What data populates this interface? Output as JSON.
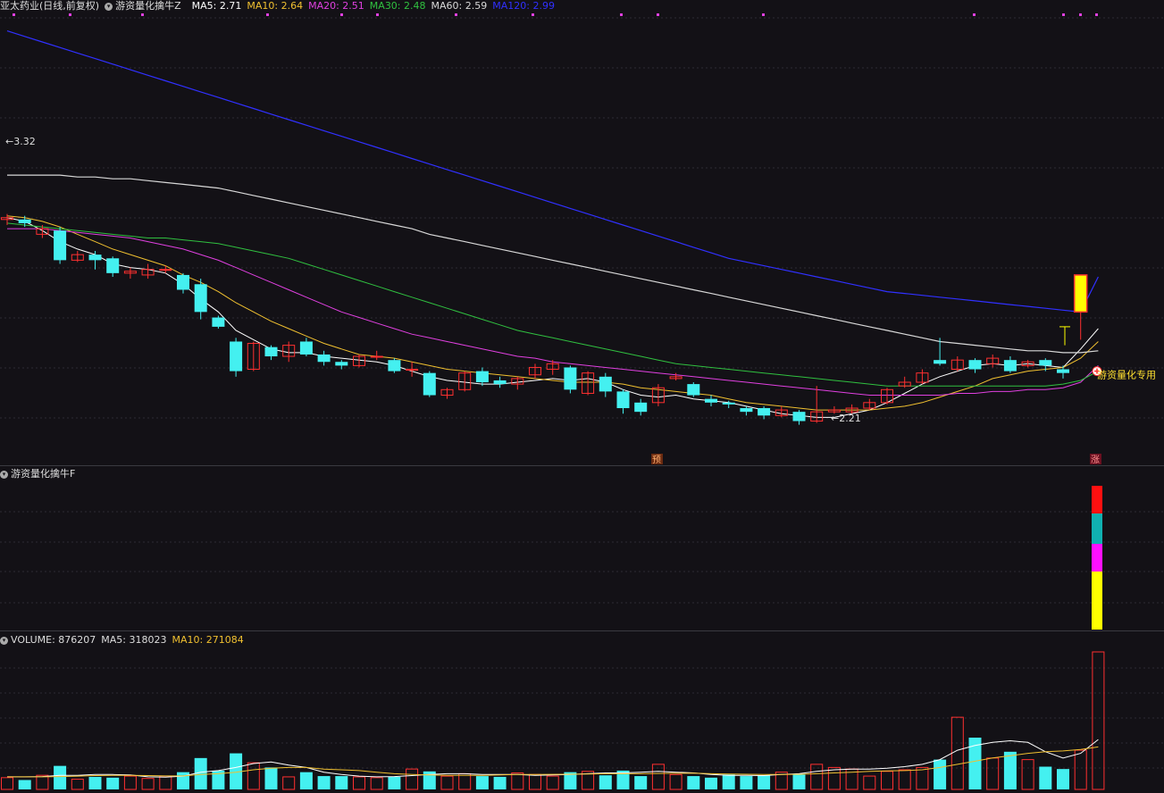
{
  "header": {
    "stock": "亚太药业(日线,前复权)",
    "indicator": "游资量化擒牛Z",
    "ma": [
      {
        "label": "MA5: 2.71",
        "color": "#ffffff"
      },
      {
        "label": "MA10: 2.64",
        "color": "#f0c030"
      },
      {
        "label": "MA20: 2.51",
        "color": "#e040e0"
      },
      {
        "label": "MA30: 2.48",
        "color": "#30c040"
      },
      {
        "label": "MA60: 2.59",
        "color": "#d8d8d8"
      },
      {
        "label": "MA120: 2.99",
        "color": "#3030ff"
      }
    ]
  },
  "panel2": {
    "title": "游资量化擒牛F"
  },
  "panel3": {
    "volume_label": "VOLUME: 876207",
    "ma5_label": "MA5: 318023",
    "ma10_label": "MA10: 271084"
  },
  "annotations": {
    "high_label": "3.32",
    "low_label": "2.21",
    "signal_label": "游资量化专用",
    "marker_yu": "预",
    "marker_zhang": "涨"
  },
  "colors": {
    "up": "#ff3030",
    "down": "#44f0f0",
    "yellow": "#ffff00",
    "bg": "#131116"
  },
  "chart_data": {
    "type": "candlestick",
    "candles": [
      [
        3.3,
        3.31,
        3.33,
        3.27
      ],
      [
        3.3,
        3.28,
        3.32,
        3.26
      ],
      [
        3.22,
        3.25,
        3.27,
        3.2
      ],
      [
        3.24,
        3.08,
        3.26,
        3.06
      ],
      [
        3.08,
        3.11,
        3.13,
        3.07
      ],
      [
        3.11,
        3.08,
        3.13,
        3.03
      ],
      [
        3.09,
        3.01,
        3.1,
        2.99
      ],
      [
        3.01,
        3.02,
        3.04,
        2.98
      ],
      [
        3.0,
        3.03,
        3.06,
        2.98
      ],
      [
        3.03,
        3.03,
        3.05,
        3.01
      ],
      [
        3.0,
        2.92,
        3.01,
        2.9
      ],
      [
        2.95,
        2.8,
        2.98,
        2.76
      ],
      [
        2.77,
        2.72,
        2.78,
        2.71
      ],
      [
        2.64,
        2.48,
        2.66,
        2.45
      ],
      [
        2.49,
        2.63,
        2.64,
        2.48
      ],
      [
        2.61,
        2.56,
        2.62,
        2.54
      ],
      [
        2.56,
        2.62,
        2.64,
        2.53
      ],
      [
        2.64,
        2.57,
        2.66,
        2.56
      ],
      [
        2.57,
        2.53,
        2.59,
        2.51
      ],
      [
        2.53,
        2.51,
        2.54,
        2.49
      ],
      [
        2.51,
        2.56,
        2.57,
        2.5
      ],
      [
        2.56,
        2.56,
        2.59,
        2.54
      ],
      [
        2.54,
        2.48,
        2.55,
        2.47
      ],
      [
        2.49,
        2.49,
        2.53,
        2.45
      ],
      [
        2.47,
        2.35,
        2.48,
        2.34
      ],
      [
        2.35,
        2.38,
        2.39,
        2.33
      ],
      [
        2.38,
        2.47,
        2.48,
        2.37
      ],
      [
        2.48,
        2.42,
        2.5,
        2.4
      ],
      [
        2.43,
        2.41,
        2.45,
        2.39
      ],
      [
        2.41,
        2.44,
        2.45,
        2.38
      ],
      [
        2.46,
        2.5,
        2.52,
        2.44
      ],
      [
        2.49,
        2.52,
        2.54,
        2.46
      ],
      [
        2.5,
        2.38,
        2.51,
        2.36
      ],
      [
        2.36,
        2.47,
        2.48,
        2.35
      ],
      [
        2.45,
        2.37,
        2.47,
        2.34
      ],
      [
        2.37,
        2.28,
        2.38,
        2.25
      ],
      [
        2.31,
        2.26,
        2.33,
        2.24
      ],
      [
        2.31,
        2.39,
        2.41,
        2.29
      ],
      [
        2.44,
        2.45,
        2.47,
        2.43
      ],
      [
        2.41,
        2.35,
        2.42,
        2.34
      ],
      [
        2.33,
        2.31,
        2.35,
        2.29
      ],
      [
        2.31,
        2.3,
        2.32,
        2.28
      ],
      [
        2.28,
        2.26,
        2.29,
        2.24
      ],
      [
        2.28,
        2.24,
        2.29,
        2.22
      ],
      [
        2.24,
        2.27,
        2.29,
        2.23
      ],
      [
        2.26,
        2.21,
        2.27,
        2.19
      ],
      [
        2.21,
        2.26,
        2.4,
        2.2
      ],
      [
        2.26,
        2.27,
        2.29,
        2.25
      ],
      [
        2.26,
        2.28,
        2.3,
        2.25
      ],
      [
        2.28,
        2.31,
        2.33,
        2.27
      ],
      [
        2.31,
        2.38,
        2.39,
        2.3
      ],
      [
        2.4,
        2.42,
        2.45,
        2.39
      ],
      [
        2.42,
        2.47,
        2.49,
        2.41
      ],
      [
        2.54,
        2.52,
        2.66,
        2.51
      ],
      [
        2.49,
        2.54,
        2.56,
        2.48
      ],
      [
        2.54,
        2.49,
        2.55,
        2.47
      ],
      [
        2.52,
        2.55,
        2.57,
        2.5
      ],
      [
        2.54,
        2.48,
        2.56,
        2.47
      ],
      [
        2.51,
        2.53,
        2.54,
        2.5
      ],
      [
        2.54,
        2.51,
        2.55,
        2.48
      ],
      [
        2.49,
        2.47,
        2.51,
        2.44
      ],
      [
        2.8,
        3.0,
        3.0,
        2.65
      ]
    ],
    "volume_max": 876207,
    "volume": [
      75000,
      60000,
      90000,
      150000,
      65000,
      80000,
      75000,
      85000,
      70000,
      85000,
      110000,
      200000,
      120000,
      230000,
      170000,
      140000,
      80000,
      110000,
      85000,
      85000,
      80000,
      75000,
      80000,
      130000,
      115000,
      85000,
      100000,
      85000,
      80000,
      105000,
      95000,
      85000,
      110000,
      115000,
      90000,
      120000,
      85000,
      160000,
      95000,
      85000,
      75000,
      95000,
      85000,
      90000,
      110000,
      100000,
      160000,
      140000,
      130000,
      85000,
      115000,
      125000,
      140000,
      190000,
      460000,
      330000,
      200000,
      240000,
      190000,
      145000,
      130000,
      250000,
      876207
    ],
    "series": [
      {
        "name": "MA5",
        "values": [
          3.31,
          3.29,
          3.24,
          3.18,
          3.14,
          3.11,
          3.06,
          3.04,
          3.03,
          3.01,
          2.95,
          2.87,
          2.8,
          2.7,
          2.65,
          2.6,
          2.58,
          2.58,
          2.56,
          2.55,
          2.54,
          2.53,
          2.51,
          2.48,
          2.45,
          2.43,
          2.42,
          2.41,
          2.41,
          2.42,
          2.43,
          2.44,
          2.43,
          2.44,
          2.42,
          2.38,
          2.35,
          2.34,
          2.35,
          2.33,
          2.32,
          2.31,
          2.29,
          2.27,
          2.25,
          2.24,
          2.23,
          2.23,
          2.25,
          2.27,
          2.31,
          2.36,
          2.41,
          2.45,
          2.48,
          2.51,
          2.52,
          2.51,
          2.52,
          2.51,
          2.5,
          2.6,
          2.71
        ]
      },
      {
        "name": "MA10",
        "values": [
          3.32,
          3.31,
          3.29,
          3.26,
          3.22,
          3.18,
          3.14,
          3.11,
          3.08,
          3.05,
          3.0,
          2.96,
          2.91,
          2.85,
          2.8,
          2.75,
          2.71,
          2.67,
          2.63,
          2.6,
          2.57,
          2.56,
          2.55,
          2.53,
          2.51,
          2.49,
          2.48,
          2.47,
          2.46,
          2.45,
          2.44,
          2.43,
          2.42,
          2.42,
          2.42,
          2.41,
          2.39,
          2.38,
          2.37,
          2.36,
          2.35,
          2.33,
          2.31,
          2.3,
          2.29,
          2.28,
          2.27,
          2.27,
          2.27,
          2.27,
          2.28,
          2.29,
          2.31,
          2.34,
          2.37,
          2.4,
          2.44,
          2.46,
          2.48,
          2.49,
          2.5,
          2.55,
          2.64
        ]
      },
      {
        "name": "MA20",
        "values": [
          3.25,
          3.25,
          3.25,
          3.24,
          3.23,
          3.22,
          3.21,
          3.2,
          3.18,
          3.16,
          3.14,
          3.11,
          3.08,
          3.04,
          3.0,
          2.96,
          2.92,
          2.88,
          2.84,
          2.8,
          2.77,
          2.74,
          2.71,
          2.68,
          2.66,
          2.64,
          2.62,
          2.6,
          2.58,
          2.56,
          2.55,
          2.53,
          2.52,
          2.51,
          2.5,
          2.49,
          2.48,
          2.47,
          2.46,
          2.45,
          2.44,
          2.43,
          2.42,
          2.41,
          2.4,
          2.39,
          2.38,
          2.37,
          2.36,
          2.35,
          2.35,
          2.35,
          2.35,
          2.35,
          2.36,
          2.36,
          2.37,
          2.37,
          2.38,
          2.38,
          2.39,
          2.42,
          2.51
        ]
      },
      {
        "name": "MA30",
        "values": [
          3.28,
          3.27,
          3.26,
          3.25,
          3.24,
          3.23,
          3.22,
          3.21,
          3.2,
          3.2,
          3.19,
          3.18,
          3.17,
          3.15,
          3.13,
          3.11,
          3.09,
          3.06,
          3.03,
          3.0,
          2.97,
          2.94,
          2.91,
          2.88,
          2.85,
          2.82,
          2.79,
          2.76,
          2.73,
          2.7,
          2.68,
          2.66,
          2.64,
          2.62,
          2.6,
          2.58,
          2.56,
          2.54,
          2.52,
          2.51,
          2.5,
          2.49,
          2.48,
          2.47,
          2.46,
          2.45,
          2.44,
          2.43,
          2.42,
          2.41,
          2.4,
          2.4,
          2.4,
          2.4,
          2.4,
          2.4,
          2.4,
          2.4,
          2.4,
          2.4,
          2.41,
          2.43,
          2.48
        ]
      },
      {
        "name": "MA60",
        "values": [
          3.54,
          3.54,
          3.54,
          3.54,
          3.53,
          3.53,
          3.52,
          3.52,
          3.51,
          3.5,
          3.49,
          3.48,
          3.47,
          3.45,
          3.43,
          3.41,
          3.39,
          3.37,
          3.35,
          3.33,
          3.31,
          3.29,
          3.27,
          3.25,
          3.22,
          3.2,
          3.18,
          3.16,
          3.14,
          3.12,
          3.1,
          3.08,
          3.06,
          3.04,
          3.02,
          3.0,
          2.98,
          2.96,
          2.94,
          2.92,
          2.9,
          2.88,
          2.86,
          2.84,
          2.82,
          2.8,
          2.78,
          2.76,
          2.74,
          2.72,
          2.7,
          2.68,
          2.66,
          2.64,
          2.63,
          2.62,
          2.61,
          2.6,
          2.59,
          2.59,
          2.58,
          2.58,
          2.59
        ]
      },
      {
        "name": "MA120",
        "values": [
          4.32,
          4.29,
          4.26,
          4.23,
          4.2,
          4.17,
          4.14,
          4.11,
          4.08,
          4.05,
          4.02,
          3.99,
          3.96,
          3.93,
          3.9,
          3.87,
          3.84,
          3.81,
          3.78,
          3.75,
          3.72,
          3.69,
          3.66,
          3.63,
          3.6,
          3.57,
          3.54,
          3.51,
          3.48,
          3.45,
          3.42,
          3.39,
          3.36,
          3.33,
          3.3,
          3.27,
          3.24,
          3.21,
          3.18,
          3.15,
          3.12,
          3.09,
          3.07,
          3.05,
          3.03,
          3.01,
          2.99,
          2.97,
          2.95,
          2.93,
          2.91,
          2.9,
          2.89,
          2.88,
          2.87,
          2.86,
          2.85,
          2.84,
          2.83,
          2.82,
          2.81,
          2.8,
          2.99
        ]
      }
    ],
    "volume_ma": [
      {
        "name": "MA5",
        "values": [
          80000,
          80000,
          82000,
          90000,
          90000,
          95000,
          95000,
          92000,
          80000,
          78000,
          85000,
          110000,
          120000,
          140000,
          165000,
          175000,
          155000,
          140000,
          110000,
          95000,
          85000,
          80000,
          82000,
          88000,
          95000,
          100000,
          100000,
          95000,
          95000,
          95000,
          90000,
          92000,
          95000,
          100000,
          105000,
          105000,
          110000,
          115000,
          110000,
          105000,
          95000,
          90000,
          90000,
          88000,
          95000,
          100000,
          115000,
          125000,
          130000,
          130000,
          135000,
          145000,
          160000,
          190000,
          250000,
          280000,
          300000,
          310000,
          300000,
          240000,
          200000,
          230000,
          318023
        ]
      },
      {
        "name": "MA10",
        "values": [
          80000,
          80000,
          80000,
          82000,
          85000,
          88000,
          90000,
          90000,
          88000,
          86000,
          86000,
          95000,
          100000,
          110000,
          125000,
          135000,
          140000,
          140000,
          130000,
          125000,
          120000,
          110000,
          100000,
          95000,
          92000,
          90000,
          90000,
          90000,
          92000,
          95000,
          95000,
          96000,
          97000,
          98000,
          100000,
          100000,
          100000,
          102000,
          103000,
          104000,
          100000,
          98000,
          97000,
          95000,
          95000,
          96000,
          100000,
          105000,
          110000,
          115000,
          118000,
          120000,
          125000,
          140000,
          160000,
          180000,
          200000,
          215000,
          230000,
          240000,
          245000,
          255000,
          271084
        ]
      }
    ]
  }
}
